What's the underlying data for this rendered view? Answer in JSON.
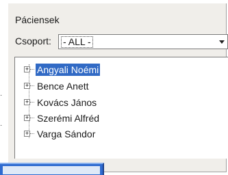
{
  "panel": {
    "title": "Páciensek"
  },
  "group_filter": {
    "label": "Csoport:",
    "value": "- ALL -"
  },
  "tree": {
    "items": [
      {
        "label": "Angyali Noémi",
        "selected": true
      },
      {
        "label": "Bence Anett",
        "selected": false
      },
      {
        "label": "Kovács János",
        "selected": false
      },
      {
        "label": "Szerémi Alfréd",
        "selected": false
      },
      {
        "label": "Varga Sándor",
        "selected": false
      }
    ]
  },
  "colors": {
    "selection": "#316ac5",
    "panel_background": "#f0eeea"
  }
}
